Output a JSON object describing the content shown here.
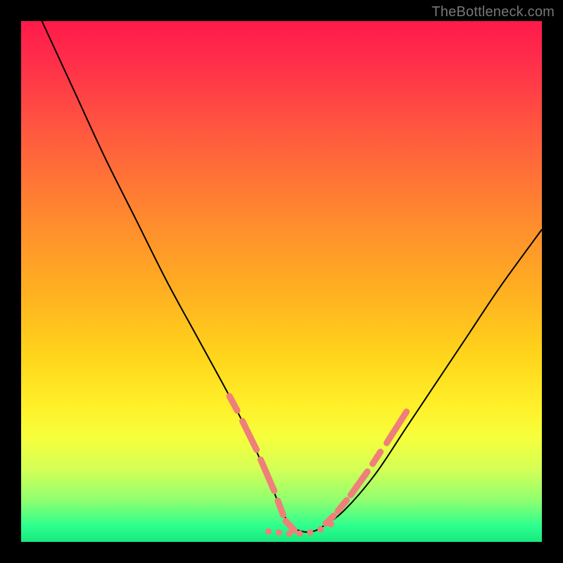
{
  "watermark": "TheBottleneck.com",
  "chart_data": {
    "type": "line",
    "title": "",
    "xlabel": "",
    "ylabel": "",
    "xlim": [
      0,
      100
    ],
    "ylim": [
      0,
      100
    ],
    "grid": false,
    "legend": false,
    "series": [
      {
        "name": "black-curve",
        "color": "#000000",
        "x": [
          4,
          10,
          16,
          22,
          28,
          34,
          40,
          44,
          48,
          50,
          52,
          54,
          56,
          58,
          62,
          68,
          74,
          80,
          86,
          92,
          100
        ],
        "y": [
          100,
          87,
          74,
          62,
          50,
          39,
          28,
          20,
          11,
          6,
          3,
          2,
          2,
          3,
          6,
          13,
          22,
          31,
          40,
          49,
          60
        ]
      },
      {
        "name": "pink-dashes-left",
        "color": "#ef7f79",
        "segments": [
          [
            [
              40.0,
              28.0
            ],
            [
              41.5,
              25.2
            ]
          ],
          [
            [
              42.5,
              23.2
            ],
            [
              45.2,
              17.7
            ]
          ],
          [
            [
              46.0,
              15.8
            ],
            [
              48.6,
              9.8
            ]
          ],
          [
            [
              49.3,
              7.9
            ],
            [
              50.3,
              5.2
            ]
          ],
          [
            [
              50.8,
              4.0
            ],
            [
              52.5,
              2.2
            ]
          ]
        ]
      },
      {
        "name": "pink-dots-bottom",
        "color": "#ef7f79",
        "points": [
          [
            47.5,
            2.0
          ],
          [
            49.5,
            1.8
          ],
          [
            51.5,
            1.6
          ],
          [
            53.5,
            1.6
          ],
          [
            55.5,
            1.8
          ],
          [
            57.5,
            2.4
          ],
          [
            59.5,
            3.4
          ]
        ]
      },
      {
        "name": "pink-dashes-right",
        "color": "#ef7f79",
        "segments": [
          [
            [
              58.5,
              3.5
            ],
            [
              60.0,
              5.0
            ]
          ],
          [
            [
              60.8,
              5.9
            ],
            [
              62.5,
              8.0
            ]
          ],
          [
            [
              63.3,
              9.0
            ],
            [
              66.5,
              13.5
            ]
          ],
          [
            [
              67.5,
              15.0
            ],
            [
              69.0,
              17.3
            ]
          ],
          [
            [
              70.2,
              19.0
            ],
            [
              74.0,
              25.0
            ]
          ]
        ]
      }
    ]
  }
}
